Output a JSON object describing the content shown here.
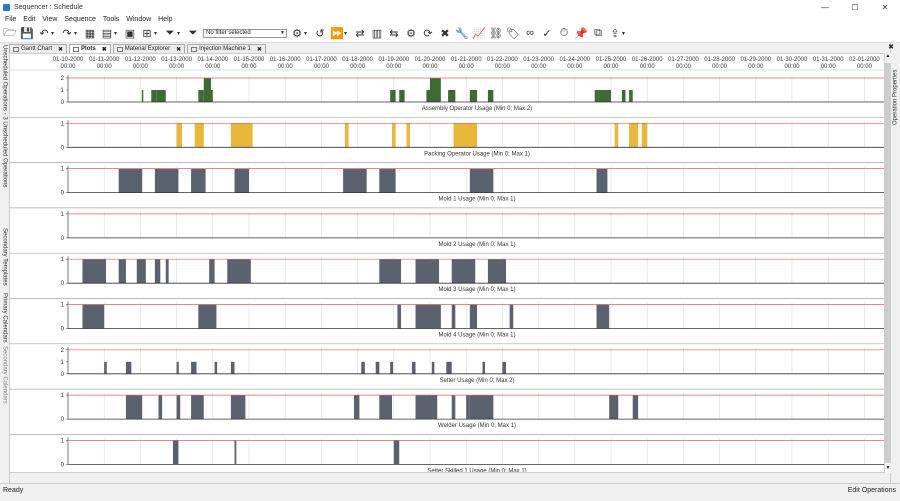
{
  "window": {
    "title": "Sequencer : Schedule",
    "minimize": "—",
    "maximize": "☐",
    "close": "✕"
  },
  "menu": [
    "File",
    "Edit",
    "View",
    "Sequence",
    "Tools",
    "Window",
    "Help"
  ],
  "toolbar": {
    "filter_value": "No filter selected"
  },
  "tabs": [
    {
      "label": "Gantt Chart",
      "active": false
    },
    {
      "label": "Plots",
      "active": true
    },
    {
      "label": "Material Explorer",
      "active": false
    },
    {
      "label": "Injection Machine 1",
      "active": false
    }
  ],
  "left_panels": [
    "Unscheduled Operations - 3 Unscheduled Operations",
    "Secondary Templates",
    "Primary Calendars",
    "Secondary Calendars"
  ],
  "right_panels": [
    "Operation Properties"
  ],
  "timeline": {
    "dates": [
      "01-10-2000",
      "01-11-2000",
      "01-12-2000",
      "01-13-2000",
      "01-14-2000",
      "01-15-2000",
      "01-16-2000",
      "01-17-2000",
      "01-18-2000",
      "01-19-2000",
      "01-20-2000",
      "01-21-2000",
      "01-22-2000",
      "01-23-2000",
      "01-24-2000",
      "01-25-2000",
      "01-26-2000",
      "01-27-2000",
      "01-28-2000",
      "01-29-2000",
      "01-30-2000",
      "01-31-2000",
      "02-01-2000"
    ],
    "time_label": "00:00"
  },
  "chart_data": [
    {
      "type": "bar",
      "title": "Assembly Operator Usage (Min 0; Max 2)",
      "ylim": [
        0,
        2
      ],
      "max": 2,
      "color": "#3e6b35",
      "x_unit": "days since 01-10-2000",
      "ticks": [
        "2",
        "1",
        "0"
      ],
      "intervals": [
        [
          2.04,
          2.08,
          1
        ],
        [
          2.3,
          2.45,
          1
        ],
        [
          2.45,
          2.7,
          1
        ],
        [
          3.6,
          3.75,
          1
        ],
        [
          3.75,
          3.95,
          2
        ],
        [
          3.95,
          4.0,
          1
        ],
        [
          8.9,
          9.05,
          1
        ],
        [
          9.15,
          9.3,
          1
        ],
        [
          9.9,
          10.0,
          1
        ],
        [
          10.0,
          10.3,
          2
        ],
        [
          10.5,
          10.7,
          1
        ],
        [
          11.1,
          11.3,
          1
        ],
        [
          11.6,
          11.75,
          1
        ],
        [
          14.55,
          14.65,
          1
        ],
        [
          14.65,
          15.0,
          1
        ],
        [
          15.3,
          15.4,
          1
        ],
        [
          15.5,
          15.6,
          1
        ]
      ]
    },
    {
      "type": "bar",
      "title": "Packing Operator Usage (Min 0; Max 1)",
      "ylim": [
        0,
        1
      ],
      "max": 1,
      "color": "#e9b73a",
      "ticks": [
        "1",
        "0"
      ],
      "intervals": [
        [
          3.0,
          3.15,
          1
        ],
        [
          3.5,
          3.75,
          1
        ],
        [
          4.5,
          5.1,
          1
        ],
        [
          7.65,
          7.75,
          1
        ],
        [
          8.95,
          9.05,
          1
        ],
        [
          9.35,
          9.45,
          1
        ],
        [
          10.65,
          11.3,
          1
        ],
        [
          15.1,
          15.2,
          1
        ],
        [
          15.5,
          15.75,
          1
        ],
        [
          15.85,
          16.0,
          1
        ]
      ]
    },
    {
      "type": "bar",
      "title": "Mold 1 Usage (Min 0; Max 1)",
      "ylim": [
        0,
        1
      ],
      "max": 1,
      "color": "#5a6270",
      "ticks": [
        "1",
        "0"
      ],
      "intervals": [
        [
          1.4,
          2.05,
          1
        ],
        [
          2.4,
          3.05,
          1
        ],
        [
          3.4,
          3.8,
          1
        ],
        [
          4.6,
          5.0,
          1
        ],
        [
          7.6,
          8.25,
          1
        ],
        [
          8.6,
          9.05,
          1
        ],
        [
          11.1,
          11.75,
          1
        ],
        [
          14.6,
          14.9,
          1
        ]
      ]
    },
    {
      "type": "bar",
      "title": "Mold 2 Usage (Min 0; Max 1)",
      "ylim": [
        0,
        1
      ],
      "max": 1,
      "color": "#5a6270",
      "ticks": [
        "1",
        "0"
      ],
      "intervals": []
    },
    {
      "type": "bar",
      "title": "Mold 3 Usage (Min 0; Max 1)",
      "ylim": [
        0,
        1
      ],
      "max": 1,
      "color": "#5a6270",
      "ticks": [
        "1",
        "0"
      ],
      "intervals": [
        [
          0.4,
          1.05,
          1
        ],
        [
          1.4,
          1.6,
          1
        ],
        [
          1.9,
          2.15,
          1
        ],
        [
          2.4,
          2.55,
          1
        ],
        [
          2.7,
          2.78,
          1
        ],
        [
          3.9,
          4.05,
          1
        ],
        [
          4.4,
          5.05,
          1
        ],
        [
          8.6,
          9.2,
          1
        ],
        [
          9.6,
          10.25,
          1
        ],
        [
          10.6,
          11.25,
          1
        ],
        [
          11.6,
          12.1,
          1
        ]
      ]
    },
    {
      "type": "bar",
      "title": "Mold 4 Usage (Min 0; Max 1)",
      "ylim": [
        0,
        1
      ],
      "max": 1,
      "color": "#5a6270",
      "ticks": [
        "1",
        "0"
      ],
      "intervals": [
        [
          0.4,
          1.0,
          1
        ],
        [
          3.6,
          4.1,
          1
        ],
        [
          9.1,
          9.2,
          1
        ],
        [
          9.6,
          10.3,
          1
        ],
        [
          10.6,
          10.7,
          1
        ],
        [
          11.1,
          11.3,
          1
        ],
        [
          12.2,
          12.3,
          1
        ],
        [
          14.6,
          14.95,
          1
        ]
      ]
    },
    {
      "type": "bar",
      "title": "Setter Usage (Min 0; Max 2)",
      "ylim": [
        0,
        2
      ],
      "max": 2,
      "color": "#5a6270",
      "ticks": [
        "2",
        "1",
        "0"
      ],
      "intervals": [
        [
          1.0,
          1.07,
          1
        ],
        [
          1.6,
          1.75,
          1
        ],
        [
          3.0,
          3.06,
          1
        ],
        [
          3.4,
          3.55,
          1
        ],
        [
          4.05,
          4.12,
          1
        ],
        [
          4.5,
          4.6,
          1
        ],
        [
          8.1,
          8.2,
          1
        ],
        [
          8.5,
          8.6,
          1
        ],
        [
          8.9,
          8.98,
          1
        ],
        [
          9.5,
          9.6,
          1
        ],
        [
          10.05,
          10.12,
          1
        ],
        [
          10.45,
          10.6,
          1
        ],
        [
          11.45,
          11.52,
          1
        ],
        [
          12.0,
          12.1,
          1
        ]
      ]
    },
    {
      "type": "bar",
      "title": "Welder Usage (Min 0; Max 1)",
      "ylim": [
        0,
        1
      ],
      "max": 1,
      "color": "#5a6270",
      "ticks": [
        "1",
        "0"
      ],
      "intervals": [
        [
          1.6,
          2.05,
          1
        ],
        [
          2.5,
          2.6,
          1
        ],
        [
          3.0,
          3.1,
          1
        ],
        [
          3.4,
          3.75,
          1
        ],
        [
          4.5,
          4.9,
          1
        ],
        [
          7.9,
          8.05,
          1
        ],
        [
          8.6,
          8.95,
          1
        ],
        [
          9.6,
          10.2,
          1
        ],
        [
          10.6,
          10.7,
          1
        ],
        [
          11.0,
          11.1,
          1
        ],
        [
          11.1,
          11.75,
          1
        ],
        [
          14.95,
          15.2,
          1
        ],
        [
          15.6,
          15.75,
          1
        ]
      ]
    },
    {
      "type": "bar",
      "title": "Setter Skilled 1 Usage (Min 0; Max 1)",
      "ylim": [
        0,
        1
      ],
      "max": 1,
      "color": "#5a6270",
      "ticks": [
        "1",
        "0"
      ],
      "intervals": [
        [
          2.9,
          3.05,
          1
        ],
        [
          4.6,
          4.65,
          1
        ],
        [
          9.0,
          9.15,
          1
        ]
      ]
    }
  ],
  "status": {
    "left": "Ready",
    "right": "Edit Operations"
  }
}
